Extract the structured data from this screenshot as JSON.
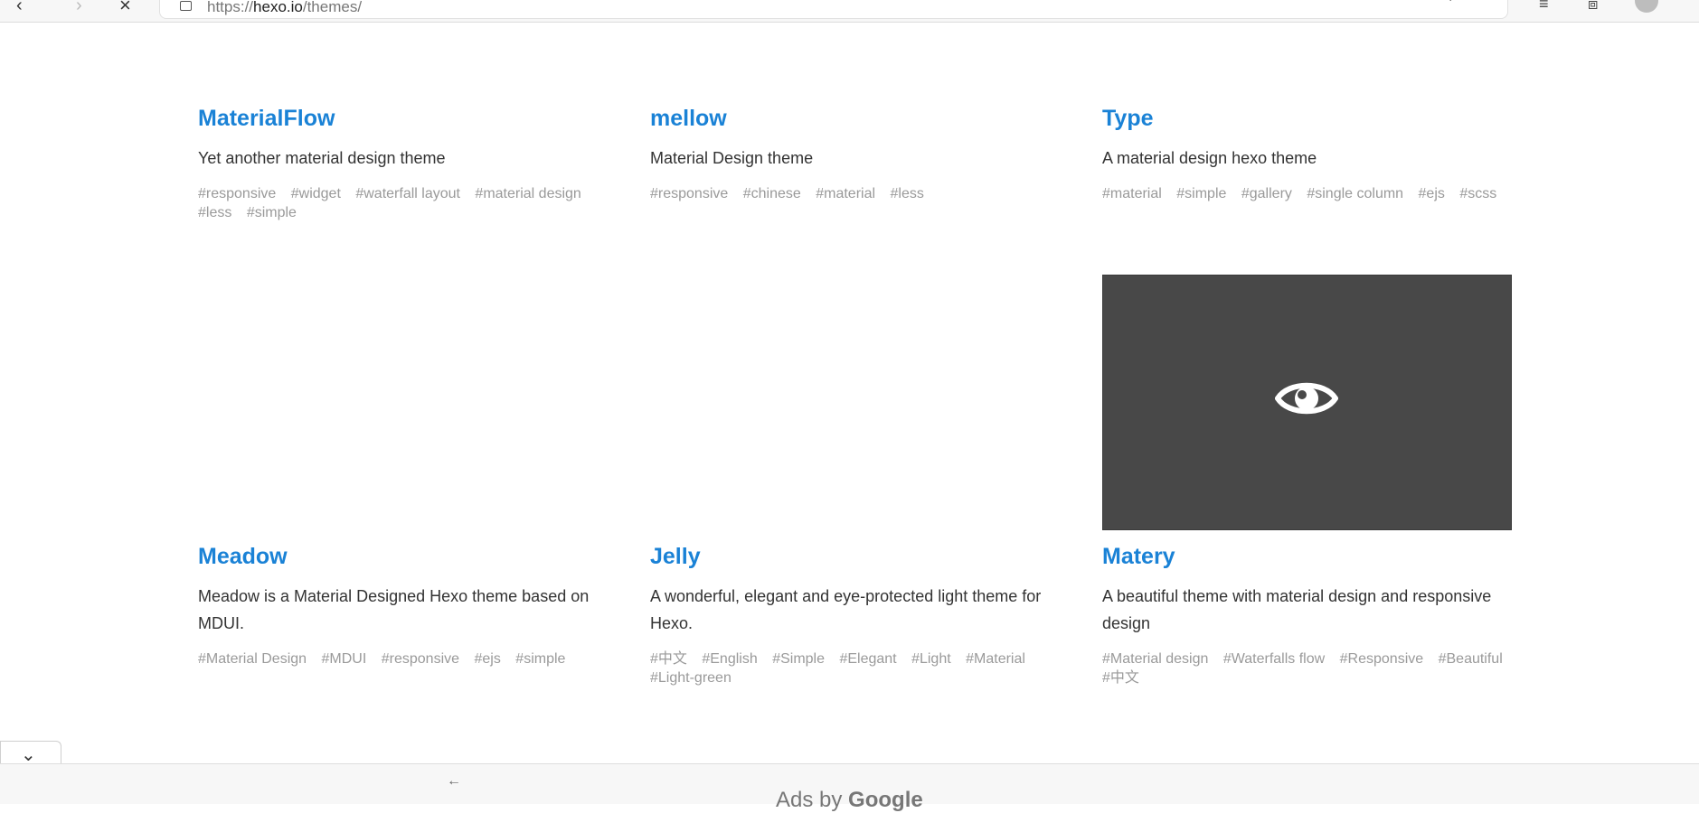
{
  "browser": {
    "url_prefix": "https://",
    "url_host": "hexo.io",
    "url_path": "/themes/"
  },
  "themes": [
    {
      "name": "MaterialFlow",
      "description": "Yet another material design theme",
      "tags": [
        "#responsive",
        "#widget",
        "#waterfall layout",
        "#material design",
        "#less",
        "#simple"
      ]
    },
    {
      "name": "mellow",
      "description": "Material Design theme",
      "tags": [
        "#responsive",
        "#chinese",
        "#material",
        "#less"
      ]
    },
    {
      "name": "Type",
      "description": "A material design hexo theme",
      "tags": [
        "#material",
        "#simple",
        "#gallery",
        "#single column",
        "#ejs",
        "#scss"
      ]
    },
    {
      "name": "Meadow",
      "description": "Meadow is a Material Designed Hexo theme based on MDUI.",
      "tags": [
        "#Material Design",
        "#MDUI",
        "#responsive",
        "#ejs",
        "#simple"
      ]
    },
    {
      "name": "Jelly",
      "description": "A wonderful, elegant and eye-protected light theme for Hexo.",
      "tags": [
        "#中文",
        "#English",
        "#Simple",
        "#Elegant",
        "#Light",
        "#Material",
        "#Light-green"
      ]
    },
    {
      "name": "Matery",
      "description": "A beautiful theme with material design and responsive design",
      "tags": [
        "#Material design",
        "#Waterfalls flow",
        "#Responsive",
        "#Beautiful",
        "#中文"
      ]
    }
  ],
  "preview": {
    "icon": "eye-icon"
  },
  "ads": {
    "prefix": "Ads by",
    "brand": "Google"
  },
  "colors": {
    "title": "#1a82d6",
    "tag": "#9a9a9a",
    "preview_bg": "#484848"
  }
}
